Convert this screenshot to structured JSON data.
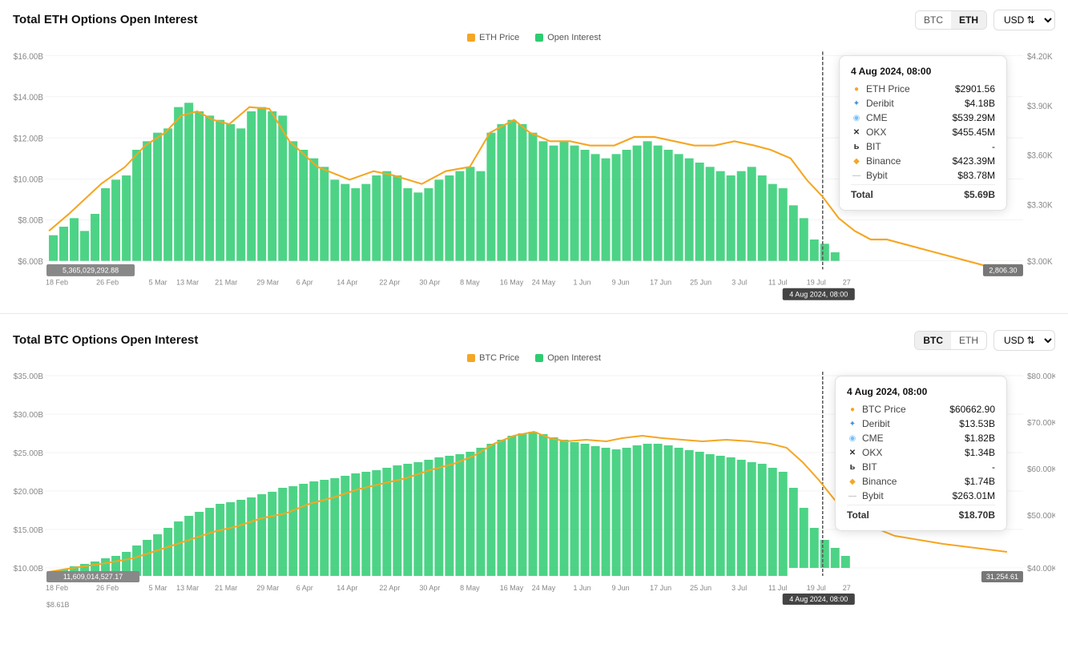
{
  "eth_chart": {
    "title": "Total ETH Options Open Interest",
    "legend": {
      "price_label": "ETH Price",
      "oi_label": "Open Interest"
    },
    "controls": {
      "btc_label": "BTC",
      "eth_label": "ETH",
      "active": "ETH",
      "currency": "USD"
    },
    "y_axis_left": [
      "$16.00B",
      "$14.00B",
      "$12.00B",
      "$10.00B",
      "$8.00B",
      "$6.00B"
    ],
    "y_axis_right": [
      "$4.20K",
      "$3.90K",
      "$3.60K",
      "$3.30K",
      "$3.00K"
    ],
    "x_labels": [
      "18 Feb",
      "26 Feb",
      "5 Mar",
      "13 Mar",
      "21 Mar",
      "29 Mar",
      "6 Apr",
      "14 Apr",
      "22 Apr",
      "30 Apr",
      "8 May",
      "16 May",
      "24 May",
      "1 Jun",
      "9 Jun",
      "17 Jun",
      "25 Jun",
      "3 Jul",
      "11 Jul",
      "19 Jul",
      "27"
    ],
    "bottom_left": "5,365,029,292.88",
    "bottom_right": "2,806.30",
    "date_marker": "4 Aug 2024, 08:00",
    "tooltip": {
      "date": "4 Aug 2024, 08:00",
      "rows": [
        {
          "icon": "●",
          "icon_color": "#f5a623",
          "label": "ETH Price",
          "value": "$2901.56"
        },
        {
          "icon": "✦",
          "icon_color": "#4a90d9",
          "label": "Deribit",
          "value": "$4.18B"
        },
        {
          "icon": "◉",
          "icon_color": "#74c0fc",
          "label": "CME",
          "value": "$539.29M"
        },
        {
          "icon": "✕",
          "icon_color": "#333",
          "label": "OKX",
          "value": "$455.45M"
        },
        {
          "icon": "ь",
          "icon_color": "#333",
          "label": "BIT",
          "value": "-"
        },
        {
          "icon": "◆",
          "icon_color": "#f5a623",
          "label": "Binance",
          "value": "$423.39M"
        },
        {
          "icon": "—",
          "icon_color": "#aaa",
          "label": "Bybit",
          "value": "$83.78M"
        }
      ],
      "total_label": "Total",
      "total_value": "$5.69B"
    }
  },
  "btc_chart": {
    "title": "Total BTC Options Open Interest",
    "legend": {
      "price_label": "BTC Price",
      "oi_label": "Open Interest"
    },
    "controls": {
      "btc_label": "BTC",
      "eth_label": "ETH",
      "active": "BTC",
      "currency": "USD"
    },
    "y_axis_left": [
      "$35.00B",
      "$30.00B",
      "$25.00B",
      "$20.00B",
      "$15.00B",
      "$10.00B"
    ],
    "y_axis_right": [
      "$80.00K",
      "$70.00K",
      "$60.00K",
      "$50.00K",
      "$40.00K"
    ],
    "x_labels": [
      "18 Feb",
      "26 Feb",
      "5 Mar",
      "13 Mar",
      "21 Mar",
      "29 Mar",
      "6 Apr",
      "14 Apr",
      "22 Apr",
      "30 Apr",
      "8 May",
      "16 May",
      "24 May",
      "1 Jun",
      "9 Jun",
      "17 Jun",
      "25 Jun",
      "3 Jul",
      "11 Jul",
      "19 Jul",
      "27"
    ],
    "bottom_left": "11,609,014,527.17",
    "bottom_right": "31,254.61",
    "date_marker": "4 Aug 2024, 08:00",
    "tooltip": {
      "date": "4 Aug 2024, 08:00",
      "rows": [
        {
          "icon": "●",
          "icon_color": "#f5a623",
          "label": "BTC Price",
          "value": "$60662.90"
        },
        {
          "icon": "✦",
          "icon_color": "#4a90d9",
          "label": "Deribit",
          "value": "$13.53B"
        },
        {
          "icon": "◉",
          "icon_color": "#74c0fc",
          "label": "CME",
          "value": "$1.82B"
        },
        {
          "icon": "✕",
          "icon_color": "#333",
          "label": "OKX",
          "value": "$1.34B"
        },
        {
          "icon": "ь",
          "icon_color": "#333",
          "label": "BIT",
          "value": "-"
        },
        {
          "icon": "◆",
          "icon_color": "#f5a623",
          "label": "Binance",
          "value": "$1.74B"
        },
        {
          "icon": "—",
          "icon_color": "#aaa",
          "label": "Bybit",
          "value": "$263.01M"
        }
      ],
      "total_label": "Total",
      "total_value": "$18.70B"
    }
  },
  "colors": {
    "bar_green": "#2ecc71",
    "bar_green_dark": "#27ae60",
    "line_gold": "#f5a623",
    "accent_blue": "#4a90d9"
  }
}
